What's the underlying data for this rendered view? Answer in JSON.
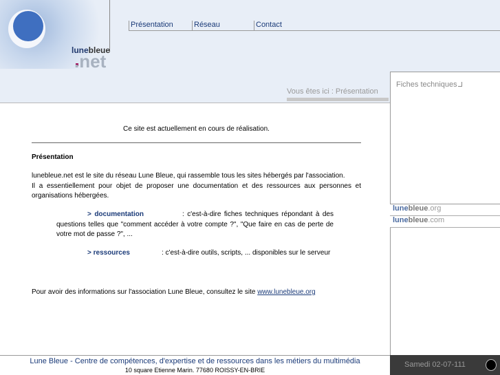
{
  "logo": {
    "brand_a": "lune",
    "brand_b": "bleue",
    "tld": ".net"
  },
  "nav": [
    {
      "label": "Présentation"
    },
    {
      "label": "Réseau"
    },
    {
      "label": "Contact"
    }
  ],
  "breadcrumb": "Vous êtes ici : Présentation",
  "sidebar": {
    "box_title": "Fiches techniques",
    "links": [
      {
        "a": "lune",
        "b": "bleue",
        "c": ".org"
      },
      {
        "a": "lune",
        "b": "bleue",
        "c": ".com"
      }
    ]
  },
  "main": {
    "notice": "Ce site est actuellement en cours de réalisation.",
    "heading": "Présentation",
    "intro": "lunebleue.net est le site du réseau Lune Bleue, qui rassemble tous les sites hébergés par l'association.",
    "intro2": "Il a essentiellement pour objet de proposer une documentation et des ressources aux personnes et organisations hébergées.",
    "items": [
      {
        "link": "> documentation",
        "text": ": c'est-à-dire fiches techniques répondant à des questions telles que \"comment accéder à votre compte ?\", \"Que faire en cas de perte de votre mot de passe ?\", ..."
      },
      {
        "link": "> ressources",
        "text": ": c'est-à-dire outils, scripts, ... disponibles sur le serveur"
      }
    ],
    "more_text": "Pour avoir des informations sur l'association Lune Bleue, consultez le site ",
    "more_link": "www.lunebleue.org"
  },
  "footer": {
    "tagline": "Lune Bleue - Centre de compétences, d'expertise et de ressources dans les métiers du multimédia",
    "address": "10 square Etienne Marin. 77680 ROISSY-EN-BRIE",
    "date": "Samedi 02-07-111"
  }
}
